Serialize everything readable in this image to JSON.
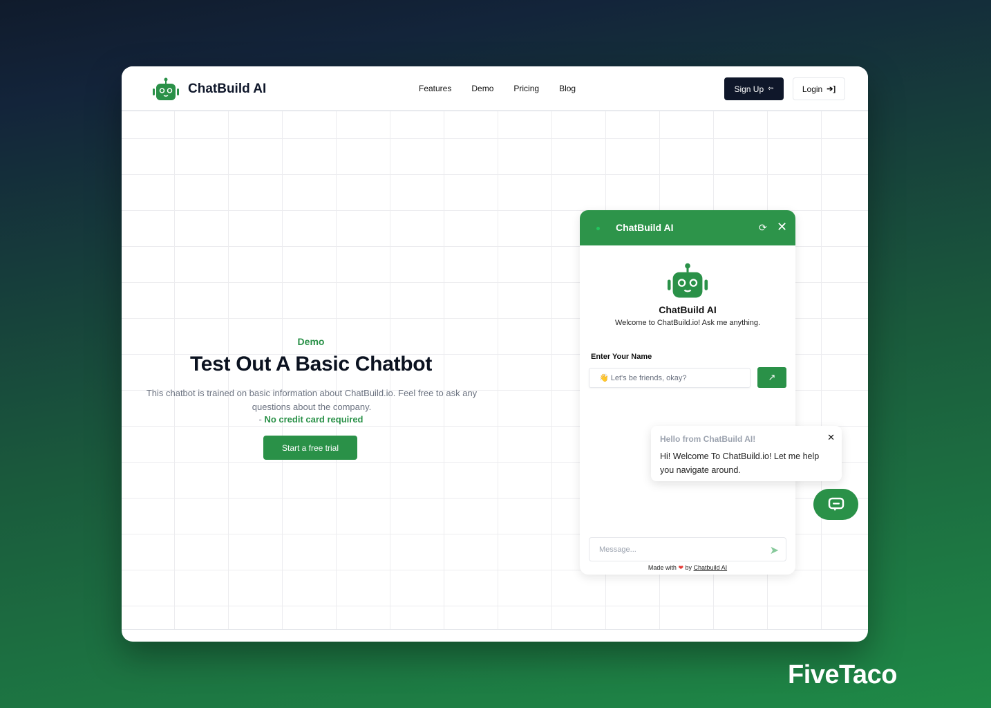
{
  "nav": {
    "brand": "ChatBuild AI",
    "links": [
      "Features",
      "Demo",
      "Pricing",
      "Blog"
    ],
    "signup": "Sign Up",
    "login": "Login"
  },
  "hero": {
    "eyebrow": "Demo",
    "title": "Test Out A Basic Chatbot",
    "description": "This chatbot is trained on basic information about ChatBuild.io. Feel free to ask any questions about the company.",
    "note_prefix": "- ",
    "note": "No credit card required",
    "cta": "Start a free trial"
  },
  "chat": {
    "title": "ChatBuild AI",
    "bot_name": "ChatBuild AI",
    "welcome": "Welcome to ChatBuild.io! Ask me anything.",
    "name_label": "Enter Your Name",
    "name_placeholder": "👋 Let's be friends, okay?",
    "message_placeholder": "Message...",
    "made_with": "Made with",
    "by": "by",
    "credit_link": "Chatbuild AI"
  },
  "popup": {
    "title": "Hello from ChatBuild AI!",
    "body": "Hi! Welcome To ChatBuild.io! Let me help you navigate around."
  },
  "watermark": "FiveTaco",
  "colors": {
    "accent": "#2a9148",
    "dark": "#0f172a"
  }
}
